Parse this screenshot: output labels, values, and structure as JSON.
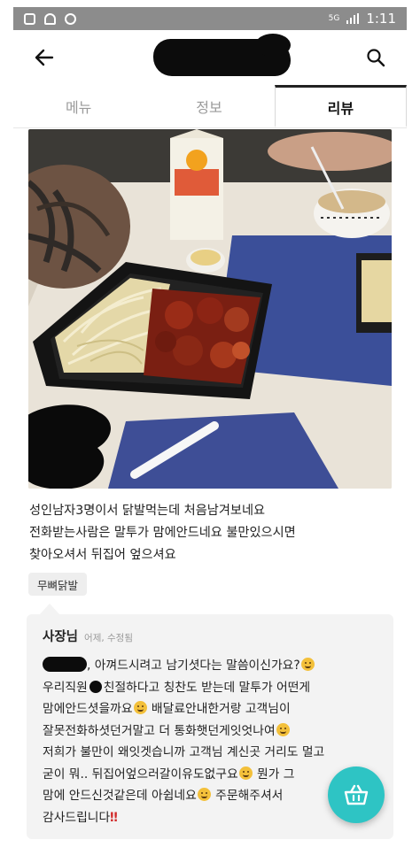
{
  "status_bar": {
    "time": "1:11",
    "network": "5G",
    "icons": [
      "bag-icon",
      "usb-icon",
      "alarm-icon",
      "signal-icon"
    ]
  },
  "header": {
    "back_icon": "arrow-left-icon",
    "title_redacted": true,
    "search_icon": "search-icon"
  },
  "tabs": [
    {
      "label": "메뉴",
      "active": false
    },
    {
      "label": "정보",
      "active": false
    },
    {
      "label": "리뷰",
      "active": true
    }
  ],
  "review": {
    "lines": [
      "성인남자3명이서 닭발먹는데 처음남겨보네요",
      "전화받는사람은 말투가 맘에안드네요  불만있으시면",
      "찾아오셔서 뒤집어 엎으셔요"
    ],
    "tag": "무뼈닭발"
  },
  "reply": {
    "author": "사장님",
    "meta": "어제, 수정됨",
    "line1_after_redact": ", 아껴드시려고 남기셧다는 말씀이신가요?",
    "line2_a": "우리직원",
    "line2_b": "친절하다고 칭찬도 받는데 말투가 어떤게",
    "line3_a": "맘에안드셧을까요",
    "line3_b": " 배달료안내한거랑 고객님이",
    "line4": "잘못전화하셧던거말고 더 통화햇던게잇엇나여",
    "line5": "저희가 불만이 왜잇겟습니까 고객님 계신곳 거리도 멀고",
    "line6_a": "굳이 뭐.. 뒤집어엎으러갈이유도없구요",
    "line6_b": " 뭔가 그",
    "line7_a": "맘에 안드신것같은데 아쉽네요",
    "line7_b": " 주문해주셔서",
    "line8_a": "감사드립니다",
    "line8_b": "‼"
  },
  "fab": {
    "icon": "shopping-basket-icon"
  },
  "colors": {
    "fab": "#2ec4c4",
    "reply_bg": "#f3f3f3",
    "statusbar": "#8c8c8c"
  }
}
